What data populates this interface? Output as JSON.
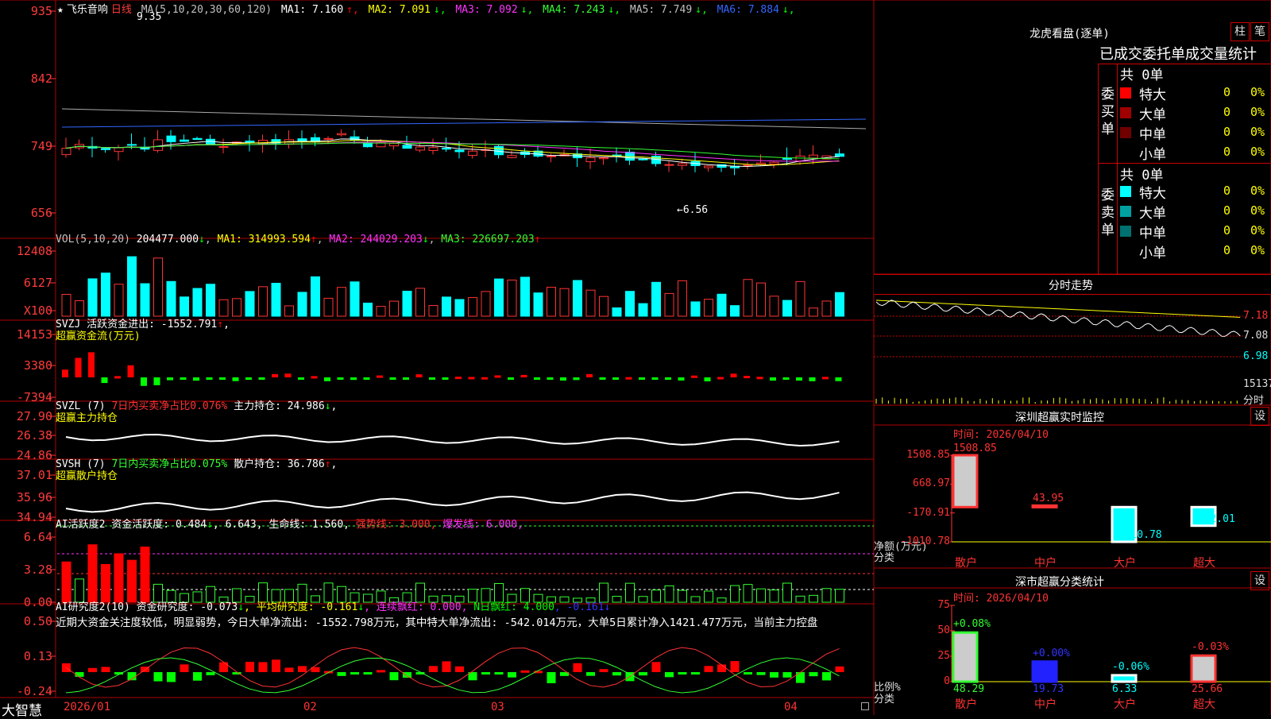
{
  "brand": "大智慧",
  "main": {
    "star": "★",
    "name": "飞乐音响",
    "period": "日线",
    "ma_label": "MA(5,10,20,30,60,120)",
    "ma": [
      {
        "t": "MA1: 7.160",
        "a": "↑",
        "c": "#ffffff"
      },
      {
        "t": "MA2: 7.091",
        "a": "↓",
        "c": "#ffff00"
      },
      {
        "t": "MA3: 7.092",
        "a": "↓",
        "c": "#ff33ff"
      },
      {
        "t": "MA4: 7.243",
        "a": "↓",
        "c": "#33ff33"
      },
      {
        "t": "MA5: 7.749",
        "a": "↓",
        "c": "#c0c0c0"
      },
      {
        "t": "MA6: 7.884",
        "a": "↓",
        "c": "#3366ff"
      }
    ],
    "high_label": "9.35",
    "low_label": "←6.56",
    "y_ticks": [
      "935",
      "842",
      "749",
      "656"
    ]
  },
  "vol": {
    "label": "VOL(5,10,20)",
    "v": "204477.000",
    "ma1": "MA1: 314993.594",
    "ma2": "MA2: 244029.203",
    "ma3": "MA3: 226697.203",
    "y_ticks": [
      "12408",
      "6127",
      "X100"
    ]
  },
  "svzj": {
    "l1": "SVZJ  活跃资金进出: -1552.791",
    "l2": "超赢资金流(万元)",
    "y_ticks": [
      "14153",
      "3380",
      "-7394"
    ]
  },
  "svzl": {
    "l1": "SVZL (7) ",
    "l1b": "7日内买卖净占比0.076%",
    "l1c": " 主力持仓: 24.986",
    "l2": "超赢主力持仓",
    "y_ticks": [
      "27.90",
      "26.38",
      "24.86"
    ]
  },
  "svsh": {
    "l1": "SVSH (7) ",
    "l1b": "7日内买卖净占比0.075%",
    "l1c": " 散户持仓: 36.786",
    "l2": "超赢散户持仓",
    "y_ticks": [
      "37.01",
      "35.96",
      "34.94"
    ]
  },
  "ai1": {
    "l1": "AI活跃度2 资金活跃度: 0.484",
    "l1b": ", 6.643, 生命线: 1.560,",
    "l1c": " 强势线: 3.000,",
    "l1d": " 爆发线: 6.000,",
    "y_ticks": [
      "6.64",
      "3.28",
      "0.00"
    ]
  },
  "ai2": {
    "l1": "AI研究度2(10) 资金研究度: -0.073",
    "l1b": ", 平均研究度: -0.161",
    "l1c": ", 连续飘红: 0.000,",
    "l1d": " N日飘红: 4.000",
    "l1e": ", -0.161",
    "l2": "近期大资金关注度较低，明显弱势，今日大单净流出: -1552.798万元，其中特大单净流出: -542.014万元，大单5日累计净入1421.477万元，当前主力控盘",
    "y_ticks": [
      "0.50",
      "0.13",
      "-0.24"
    ]
  },
  "xaxis": [
    "2026/01",
    "02",
    "03",
    "04"
  ],
  "right": {
    "lhb_title": "龙虎看盘(逐单)",
    "btn1": "柱",
    "btn2": "笔",
    "stats_title": "已成交委托单成交量统计",
    "buy_label": "委买单",
    "sell_label": "委卖单",
    "count_buy": "共 0单",
    "count_sell": "共 0单",
    "rows_buy": [
      {
        "n": "特大",
        "v": "0",
        "p": "0%",
        "c": "#ff0000"
      },
      {
        "n": "大单",
        "v": "0",
        "p": "0%",
        "c": "#a00000"
      },
      {
        "n": "中单",
        "v": "0",
        "p": "0%",
        "c": "#700000"
      },
      {
        "n": "小单",
        "v": "0",
        "p": "0%",
        "c": ""
      }
    ],
    "rows_sell": [
      {
        "n": "特大",
        "v": "0",
        "p": "0%",
        "c": "#00ffff"
      },
      {
        "n": "大单",
        "v": "0",
        "p": "0%",
        "c": "#00a0a0"
      },
      {
        "n": "中单",
        "v": "0",
        "p": "0%",
        "c": "#007070"
      },
      {
        "n": "小单",
        "v": "0",
        "p": "0%",
        "c": ""
      }
    ],
    "intraday_title": "分时走势",
    "intraday_ticks": [
      "7.18",
      "7.08",
      "6.98",
      "15137",
      "分时"
    ],
    "mon_title": "深圳超赢实时监控",
    "mon_btn": "设",
    "mon_time": "时间: 2026/04/10",
    "mon_ticks": [
      "1508.85",
      "668.97",
      "-170.91",
      "-1010.78"
    ],
    "mon_unit": "净额(万元)",
    "mon_cat": "分类",
    "cls_title": "深市超赢分类统计",
    "cls_btn": "设",
    "cls_time": "时间: 2026/04/10",
    "cls_ticks": [
      "75",
      "50",
      "25",
      "0"
    ],
    "cls_unit": "比例%",
    "cls_cat": "分类"
  },
  "chart_data": [
    {
      "type": "bar",
      "title": "深圳超赢实时监控",
      "categories": [
        "散户",
        "中户",
        "大户",
        "超大"
      ],
      "values": [
        1508.85,
        43.95,
        -1010.78,
        -542.01
      ],
      "ylabel": "净额(万元)",
      "ylim": [
        -1010.78,
        1508.85
      ]
    },
    {
      "type": "bar",
      "title": "深市超赢分类统计",
      "categories": [
        "散户",
        "中户",
        "大户",
        "超大"
      ],
      "values": [
        48.29,
        19.73,
        6.33,
        25.66
      ],
      "changes": [
        "+0.08%",
        "+0.00%",
        "-0.06%",
        "-0.03%"
      ],
      "ylabel": "比例%",
      "ylim": [
        0,
        75
      ]
    }
  ]
}
